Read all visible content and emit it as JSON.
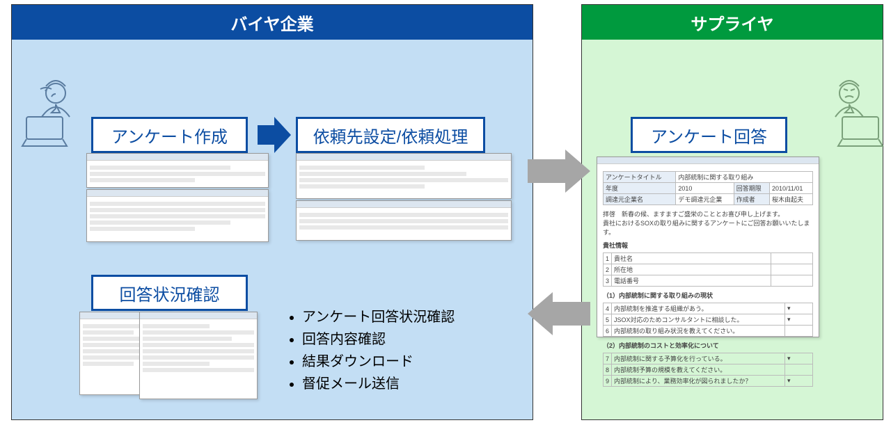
{
  "buyer": {
    "title": "バイヤ企業",
    "steps": {
      "create": "アンケート作成",
      "request": "依頼先設定/依頼処理",
      "status": "回答状況確認"
    },
    "bullets": [
      "アンケート回答状況確認",
      "回答内容確認",
      "結果ダウンロード",
      "督促メール送信"
    ]
  },
  "supplier": {
    "title": "サプライヤ",
    "step": "アンケート回答",
    "form": {
      "title_label": "アンケートタイトル",
      "title_value": "内部統制に関する取り組み",
      "year_label": "年度",
      "year_value": "2010",
      "deadline_label": "回答期限",
      "deadline_value": "2010/11/01",
      "from_label": "調達元企業名",
      "from_value": "デモ調達元企業",
      "author_label": "作成者",
      "author_value": "桜木由起夫",
      "greeting1": "拝啓　新春の候、ますますご盛栄のこととお喜び申し上げます。",
      "greeting2": "貴社におけるSOXの取り組みに関するアンケートにご回答お願いいたします。",
      "sec0": "貴社情報",
      "q01": "貴社名",
      "q02": "所在地",
      "q03": "電話番号",
      "sec1": "（1）内部統制に関する取り組みの現状",
      "q11": "内部統制を推進する組織があう。",
      "q12": "JSOX対応のためコンサルタントに相談した。",
      "q13": "内部統制の取り組み状況を教えてください。",
      "sec2": "（2）内部統制のコストと効率化について",
      "q21": "内部統制に関する予算化を行っている。",
      "q22": "内部統制予算の規模を教えてください。",
      "q23": "内部統制により、業務効率化が図られましたか？"
    }
  },
  "colors": {
    "buyer_bg": "#c3def4",
    "buyer_head": "#0c4da2",
    "supplier_bg": "#d5f6d5",
    "supplier_head": "#009a3e",
    "arrow_grey": "#a6a6a6"
  }
}
